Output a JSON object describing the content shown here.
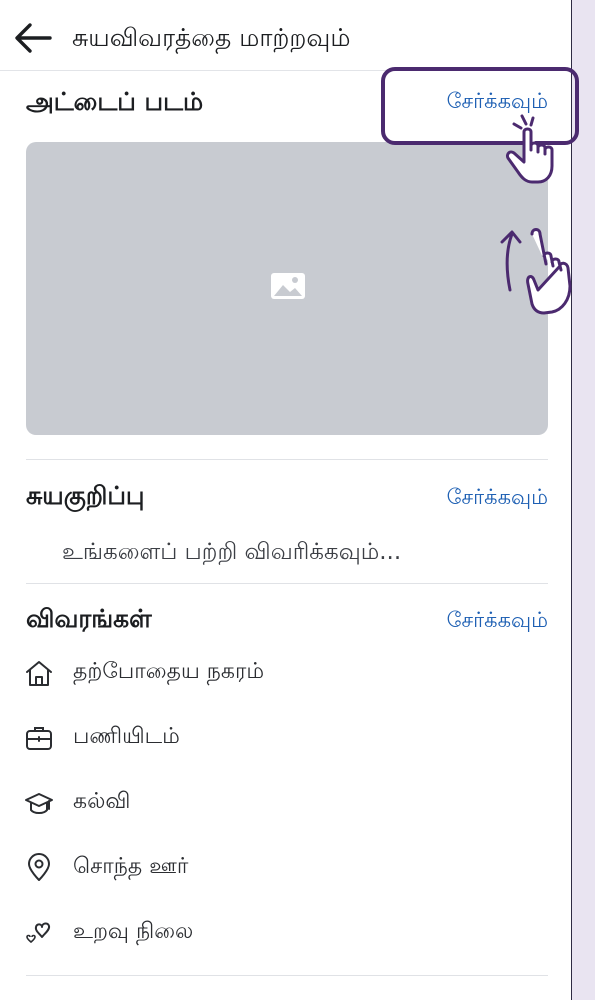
{
  "header": {
    "title": "சுயவிவரத்தை மாற்றவும்",
    "back_icon": "arrow-left-icon"
  },
  "cover": {
    "title": "அட்டைப் படம்",
    "add_label": "சேர்க்கவும்",
    "placeholder_icon": "image-icon"
  },
  "bio": {
    "title": "சுயகுறிப்பு",
    "add_label": "சேர்க்கவும்",
    "placeholder": "உங்களைப் பற்றி விவரிக்கவும்..."
  },
  "details": {
    "title": "விவரங்கள்",
    "add_label": "சேர்க்கவும்",
    "items": [
      {
        "label": "தற்போதைய நகரம்",
        "icon": "home-icon"
      },
      {
        "label": "பணியிடம்",
        "icon": "briefcase-icon"
      },
      {
        "label": "கல்வி",
        "icon": "graduation-cap-icon"
      },
      {
        "label": "சொந்த ஊர்",
        "icon": "location-pin-icon"
      },
      {
        "label": "உறவு நிலை",
        "icon": "hearts-icon"
      }
    ]
  },
  "colors": {
    "link": "#1d5fb3",
    "highlight": "#4b2a6f",
    "cover_placeholder": "#c8cbd1",
    "backdrop": "#e9e4f1"
  }
}
